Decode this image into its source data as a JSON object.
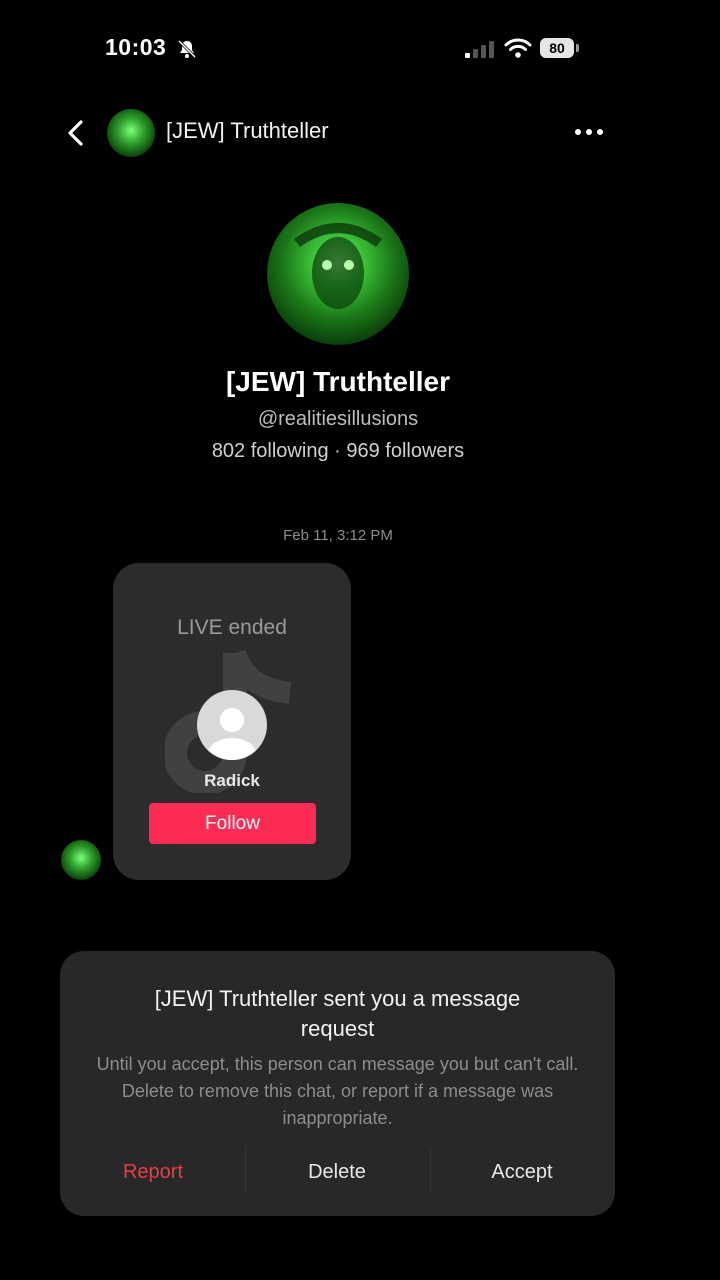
{
  "status_bar": {
    "time": "10:03",
    "battery": "80",
    "icons": [
      "bell-slash-icon",
      "signal-icon",
      "wifi-icon",
      "battery-icon"
    ]
  },
  "header": {
    "title": "[JEW] Truthteller",
    "back_icon": "chevron-left-icon",
    "more_icon": "more-dots-icon"
  },
  "profile": {
    "name": "[JEW] Truthteller",
    "handle": "@realitiesillusions",
    "stats": "802 following · 969 followers"
  },
  "chat": {
    "timestamp": "Feb 11, 3:12 PM",
    "live_card": {
      "label": "LIVE ended",
      "host_name": "Radick",
      "follow_label": "Follow"
    }
  },
  "request": {
    "title": "[JEW] Truthteller sent you a message request",
    "body": "Until you accept, this person can message you but can't call. Delete to remove this chat, or report if a message was inappropriate.",
    "report_label": "Report",
    "delete_label": "Delete",
    "accept_label": "Accept"
  },
  "colors": {
    "background": "#000000",
    "follow": "#fe2c55",
    "report": "#e0414b",
    "panel": "#282828",
    "card": "#2c2c2c",
    "avatar_green": "#2fa32c"
  }
}
